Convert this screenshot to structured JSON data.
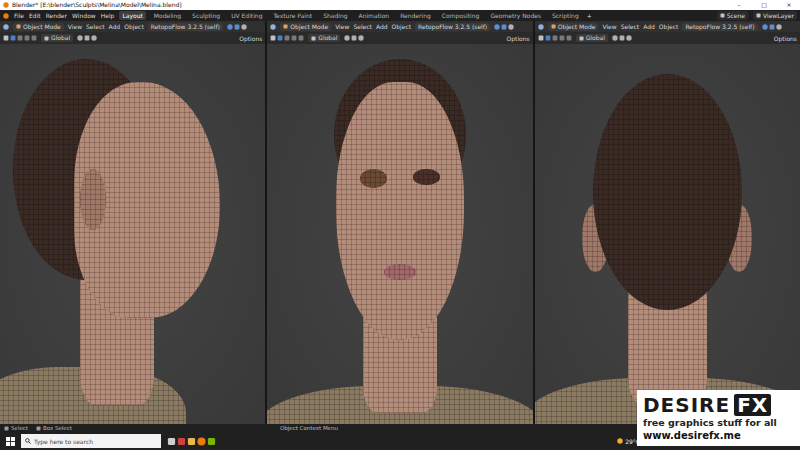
{
  "window": {
    "title": "Blender* [E:\\blender\\Sculpts\\Melina\\Model\\Melina.blend]",
    "controls": [
      "–",
      "□",
      "×"
    ]
  },
  "menu": [
    "File",
    "Edit",
    "Render",
    "Window",
    "Help"
  ],
  "workspaces": [
    {
      "label": "Layout",
      "selected": true
    },
    {
      "label": "Modeling",
      "selected": false
    },
    {
      "label": "Sculpting",
      "selected": false
    },
    {
      "label": "UV Editing",
      "selected": false
    },
    {
      "label": "Texture Paint",
      "selected": false
    },
    {
      "label": "Shading",
      "selected": false
    },
    {
      "label": "Animation",
      "selected": false
    },
    {
      "label": "Rendering",
      "selected": false
    },
    {
      "label": "Compositing",
      "selected": false
    },
    {
      "label": "Geometry Nodes",
      "selected": false
    },
    {
      "label": "Scripting",
      "selected": false
    }
  ],
  "add_workspace": "+",
  "scene": "Scene",
  "view_layer": "ViewLayer",
  "viewports": [
    {
      "kind": "side",
      "mode": "Object Mode",
      "menu": [
        "View",
        "Select",
        "Add",
        "Object"
      ],
      "addon": "RetopoFlow 3.2.5 (self)",
      "orientation": "Global",
      "options": "Options"
    },
    {
      "kind": "front",
      "mode": "Object Mode",
      "menu": [
        "View",
        "Select",
        "Add",
        "Object"
      ],
      "addon": "RetopoFlow 3.2.5 (self)",
      "orientation": "Global",
      "options": "Options"
    },
    {
      "kind": "back",
      "mode": "Object Mode",
      "menu": [
        "View",
        "Select",
        "Add",
        "Object"
      ],
      "addon": "RetopoFlow 3.2.5 (self)",
      "orientation": "Global",
      "options": "Options"
    }
  ],
  "status_bar": {
    "left": [
      "Select",
      "Box Select"
    ],
    "center": "Object Context Menu"
  },
  "taskbar": {
    "search_placeholder": "Type here to search",
    "weather": "29°C"
  },
  "watermark": {
    "logo_left": "DESIRE",
    "logo_right": "FX",
    "tagline": "free graphics stuff for all",
    "url": "www.desirefx.me"
  }
}
